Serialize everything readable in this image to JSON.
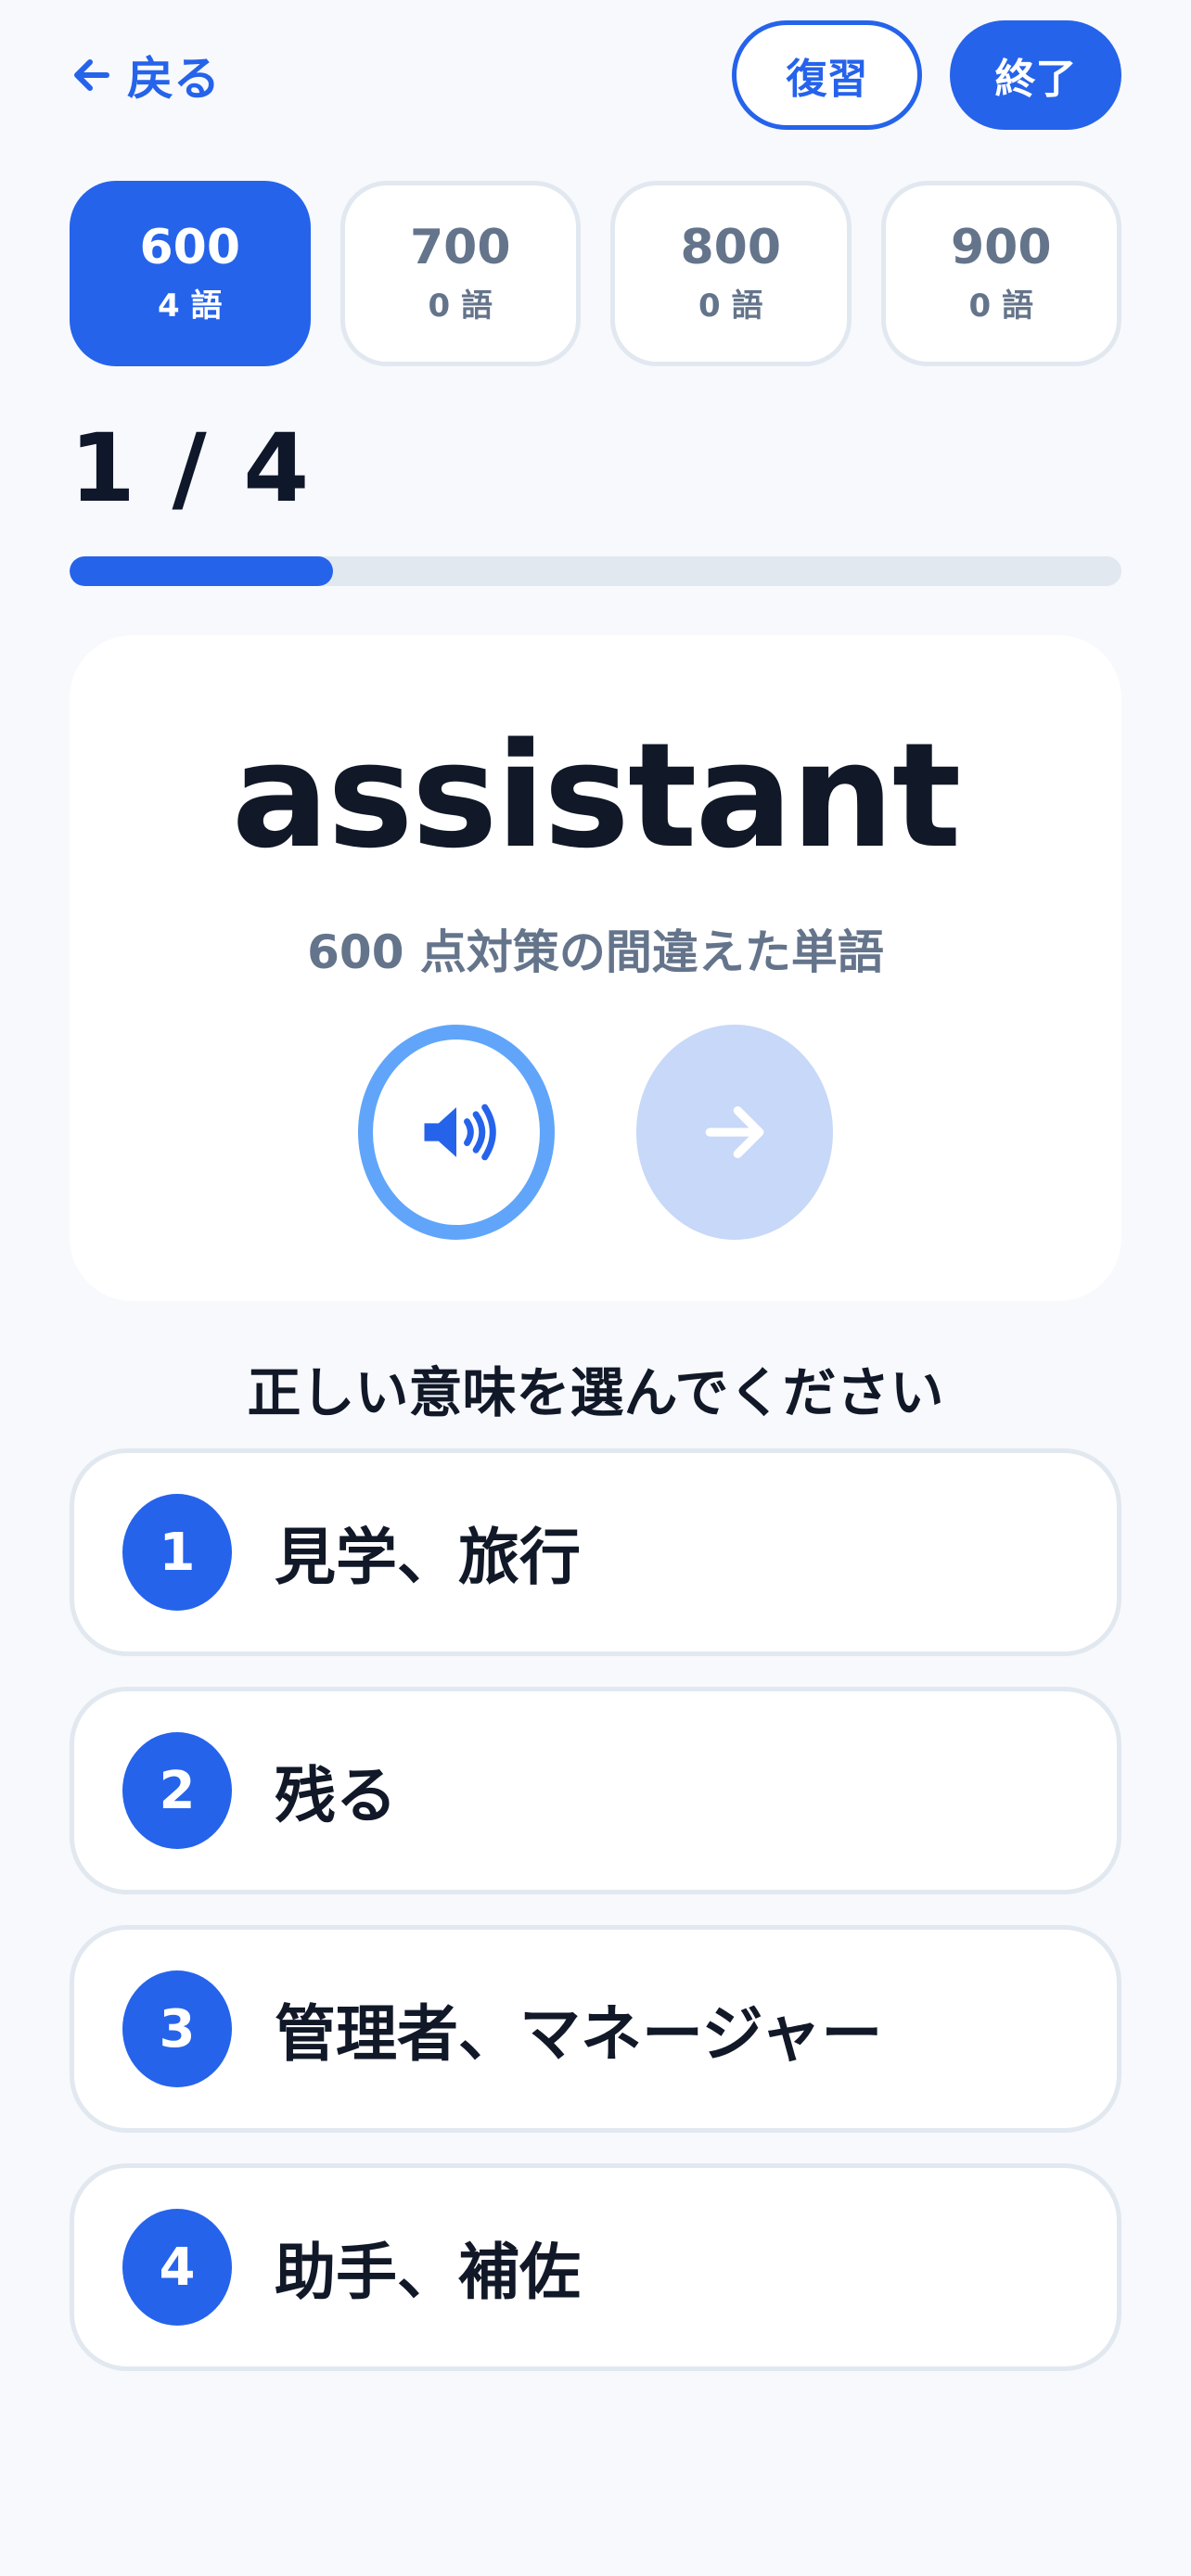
{
  "header": {
    "back_label": "戻る",
    "review_label": "復習",
    "end_label": "終了"
  },
  "levels": [
    {
      "score": "600",
      "count": "4 語",
      "active": true
    },
    {
      "score": "700",
      "count": "0 語",
      "active": false
    },
    {
      "score": "800",
      "count": "0 語",
      "active": false
    },
    {
      "score": "900",
      "count": "0 語",
      "active": false
    }
  ],
  "progress": {
    "label": "1 / 4",
    "current": 1,
    "total": 4
  },
  "card": {
    "word": "assistant",
    "subtitle": "600 点対策の間違えた単語",
    "audio_icon": "speaker-icon",
    "next_icon": "arrow-right-icon"
  },
  "prompt": "正しい意味を選んでください",
  "options": [
    {
      "number": "1",
      "text": "見学、旅行"
    },
    {
      "number": "2",
      "text": "残る"
    },
    {
      "number": "3",
      "text": "管理者、マネージャー"
    },
    {
      "number": "4",
      "text": "助手、補佐"
    }
  ],
  "colors": {
    "accent": "#2563eb",
    "accent_light": "#60a5fa",
    "disabled": "#c7d8f8",
    "muted_text": "#64748b",
    "border": "#e2e8f0",
    "background": "#f7f9fc"
  }
}
